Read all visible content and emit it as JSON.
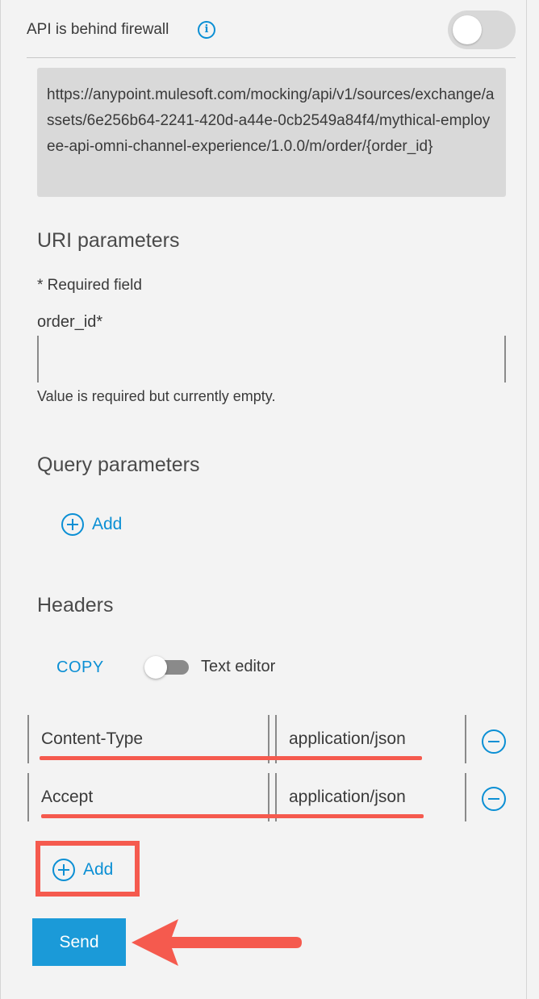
{
  "firewall": {
    "label": "API is behind firewall",
    "info_icon": "info-icon",
    "toggle_on": false
  },
  "request_url": "https://anypoint.mulesoft.com/mocking/api/v1/sources/exchange/assets/6e256b64-2241-420d-a44e-0cb2549a84f4/mythical-employee-api-omni-channel-experience/1.0.0/m/order/{order_id}",
  "uri_parameters": {
    "title": "URI parameters",
    "required_note": "* Required field",
    "field_label": "order_id*",
    "field_value": "",
    "error_message": "Value is required but currently empty."
  },
  "query_parameters": {
    "title": "Query parameters",
    "add_label": "Add"
  },
  "headers": {
    "title": "Headers",
    "copy_label": "COPY",
    "text_editor_label": "Text editor",
    "text_editor_on": false,
    "rows": [
      {
        "key": "Content-Type",
        "value": "application/json"
      },
      {
        "key": "Accept",
        "value": "application/json"
      }
    ],
    "add_label": "Add"
  },
  "send_label": "Send",
  "colors": {
    "accent": "#0b8fd4",
    "send_button": "#1b9ad8",
    "annotation": "#f55a4e",
    "background": "#f3f3f3"
  }
}
